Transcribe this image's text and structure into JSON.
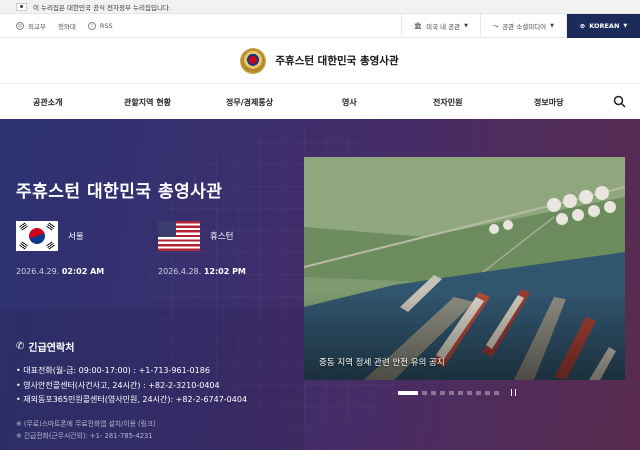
{
  "gov_banner": {
    "text": "이 누리집은 대한민국 공식 전자정부 누리집입니다."
  },
  "utility": {
    "links": [
      "외교부",
      "청와대",
      "RSS"
    ],
    "mission_label": "미국 내 공관",
    "social_label": "공관 소셜미디어",
    "language": "KOREAN"
  },
  "header": {
    "site_title": "주휴스턴 대한민국 총영사관"
  },
  "nav": {
    "items": [
      "공관소개",
      "관할지역 현황",
      "정무/경제통상",
      "영사",
      "전자민원",
      "정보마당"
    ]
  },
  "hero": {
    "title": "주휴스턴 대한민국 총영사관",
    "cities": [
      {
        "name": "서울",
        "date": "2026.4.29.",
        "time": "02:02 AM"
      },
      {
        "name": "휴스턴",
        "date": "2026.4.28.",
        "time": "12:02 PM"
      }
    ]
  },
  "emergency": {
    "title": "긴급연락처",
    "items": [
      "대표전화(월-금: 09:00-17:00) : +1-713-961-0186",
      "영사안전콜센터(사건사고, 24시간) : +82-2-3210-0404",
      "재외동포365민원콜센터(영사민원, 24시간): +82-2-6747-0404"
    ],
    "notes": [
      "※ (무료)스마트폰에 무료전화앱 설치/이용 (링크)",
      "※ 긴급전화(근무시간외): +1- 281-785-4231"
    ]
  },
  "slide": {
    "caption": "중동 지역 정세 관련 안전 유의 공지",
    "total": 10,
    "active": 1
  },
  "colors": {
    "lang_bg": "#1c2c5a",
    "hero_start": "#2d3270",
    "hero_end": "#5a2b4e"
  }
}
